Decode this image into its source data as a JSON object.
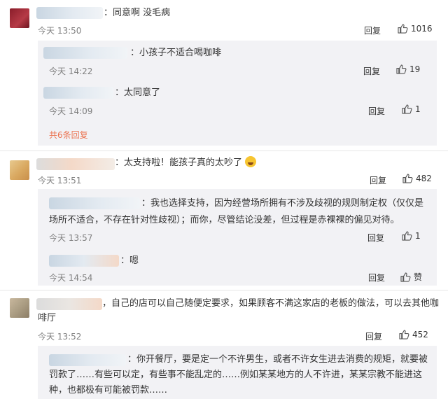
{
  "comments": [
    {
      "text": "：同意啊 没毛病",
      "time": "今天 13:50",
      "reply_label": "回复",
      "likes": "1016",
      "subs": [
        {
          "text": "：小孩子不适合喝咖啡",
          "time": "今天 14:22",
          "reply_label": "回复",
          "likes": "19"
        },
        {
          "text": "：太同意了",
          "time": "今天 14:09",
          "reply_label": "回复",
          "likes": "1"
        }
      ],
      "more_label": "共6条回复"
    },
    {
      "text": "：太支持啦！能孩子真的太吵了",
      "time": "今天 13:51",
      "reply_label": "回复",
      "likes": "482",
      "subs": [
        {
          "text_line1": "：我也选择支持，因为经营场所拥有不涉及歧视的规则制定权（仅仅是",
          "text_line2": "场所不适合，不存在针对性歧视）；而你，尽管结论没差，但过程是赤裸裸的偏见对待。",
          "time": "今天 13:57",
          "reply_label": "回复",
          "likes": "1"
        },
        {
          "text": "：嗯",
          "time": "今天 14:54",
          "reply_label": "回复",
          "likes": "赞"
        }
      ]
    },
    {
      "text_line1": "，自己的店可以自己随便定要求，如果顾客不满这家店的老板的做法，可以去其他咖",
      "text_line2": "啡厅",
      "time": "今天 13:52",
      "reply_label": "回复",
      "likes": "452",
      "subs": [
        {
          "text_line1": "：你开餐厅，要是定一个不许男生，或者不许女生进去消费的规矩，就要被",
          "text_line2": "罚款了……有些可以定，有些事不能乱定的……例如某某地方的人不许进，某某宗教不能进这",
          "text_line3": "种，也都极有可能被罚款……"
        }
      ]
    }
  ],
  "colors": {
    "accent": "#eb7350",
    "time": "#808080",
    "subbox": "#f2f2f5"
  }
}
